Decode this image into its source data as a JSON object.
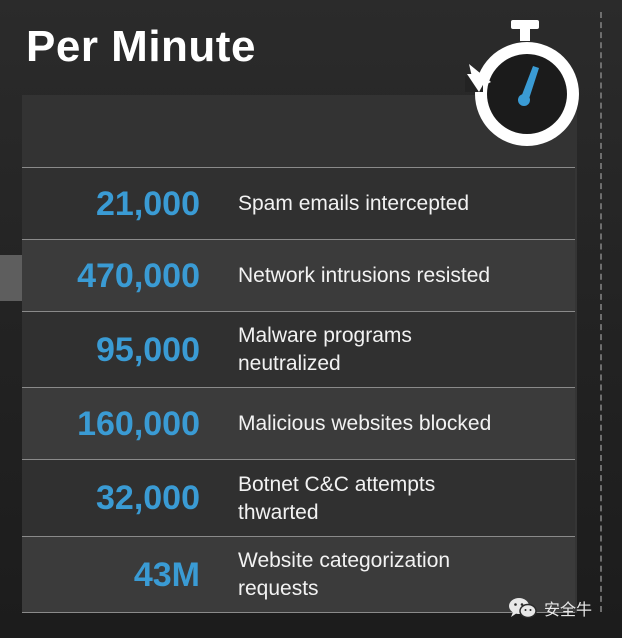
{
  "title": "Per Minute",
  "accent_color": "#3a9bd4",
  "stats": [
    {
      "value": "21,000",
      "label": "Spam emails intercepted"
    },
    {
      "value": "470,000",
      "label": "Network intrusions resisted"
    },
    {
      "value": "95,000",
      "label": "Malware programs neutralized"
    },
    {
      "value": "160,000",
      "label": "Malicious websites blocked"
    },
    {
      "value": "32,000",
      "label": "Botnet C&C attempts thwarted"
    },
    {
      "value": "43M",
      "label": "Website categorization requests"
    }
  ],
  "icons": {
    "stopwatch": "stopwatch-icon",
    "watermark": "wechat-icon"
  },
  "watermark": {
    "text": "安全牛"
  }
}
